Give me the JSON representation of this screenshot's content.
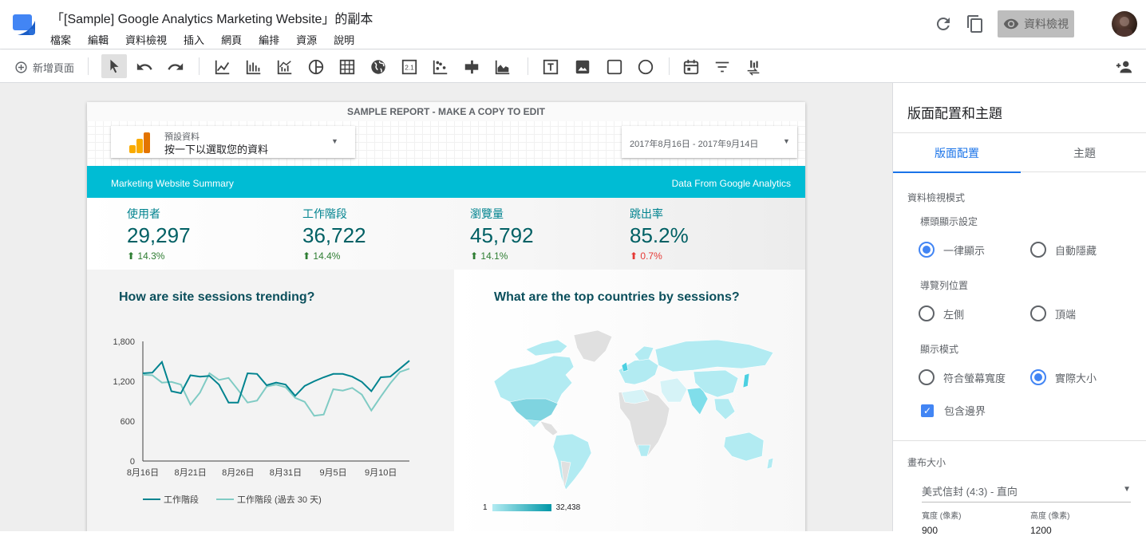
{
  "app": {
    "doc_title": "「[Sample] Google Analytics Marketing Website」的副本",
    "menu": [
      "檔案",
      "編輯",
      "資料檢視",
      "插入",
      "網頁",
      "編排",
      "資源",
      "說明"
    ],
    "view_button": "資料檢視"
  },
  "toolbar": {
    "add_page": "新增頁面",
    "tools": [
      "select-icon",
      "undo-icon",
      "redo-icon",
      "time-series-icon",
      "bar-chart-icon",
      "combo-chart-icon",
      "pie-chart-icon",
      "table-icon",
      "geo-map-icon",
      "scorecard-icon",
      "scatter-icon",
      "bullet-chart-icon",
      "area-chart-icon",
      "text-icon",
      "image-icon",
      "rectangle-icon",
      "circle-icon",
      "date-range-icon",
      "filter-icon",
      "data-control-icon"
    ],
    "share_icon": "person-add-icon"
  },
  "report": {
    "banner": "SAMPLE REPORT - MAKE A COPY TO EDIT",
    "data_picker": {
      "small": "預設資料",
      "main": "按一下以選取您的資料"
    },
    "date_range": "2017年8月16日 - 2017年9月14日",
    "summary_left": "Marketing Website Summary",
    "summary_right": "Data From Google Analytics",
    "kpis": [
      {
        "label": "使用者",
        "value": "29,297",
        "change": "14.3%",
        "trend": "up-good"
      },
      {
        "label": "工作階段",
        "value": "36,722",
        "change": "14.4%",
        "trend": "up-good"
      },
      {
        "label": "瀏覽量",
        "value": "45,792",
        "change": "14.1%",
        "trend": "up-good"
      },
      {
        "label": "跳出率",
        "value": "85.2%",
        "change": "0.7%",
        "trend": "up-bad"
      }
    ],
    "trend_title": "How are site sessions trending?",
    "map_title": "What are the top countries by sessions?",
    "map_legend": {
      "min": "1",
      "max": "32,438"
    }
  },
  "chart_data": {
    "type": "line",
    "title": "How are site sessions trending?",
    "ylim": [
      0,
      1800
    ],
    "yticks": [
      "0",
      "600",
      "1,200",
      "1,800"
    ],
    "xticks": [
      "8月16日",
      "8月21日",
      "8月26日",
      "8月31日",
      "9月5日",
      "9月10日"
    ],
    "colors": [
      "#00838f",
      "#80cbc4"
    ],
    "series": [
      {
        "name": "工作階段",
        "values": [
          1320,
          1330,
          1490,
          1050,
          1020,
          1290,
          1270,
          1280,
          1150,
          880,
          880,
          1320,
          1310,
          1140,
          1180,
          1150,
          980,
          1130,
          1200,
          1260,
          1310,
          1310,
          1270,
          1190,
          1050,
          1260,
          1270,
          1390,
          1510
        ]
      },
      {
        "name": "工作階段 (過去 30 天)",
        "values": [
          1300,
          1290,
          1180,
          1190,
          1150,
          850,
          1030,
          1320,
          1220,
          1250,
          1070,
          880,
          910,
          1120,
          1150,
          1110,
          950,
          890,
          680,
          700,
          1080,
          1060,
          1100,
          1000,
          760,
          970,
          1170,
          1340,
          1390
        ]
      }
    ]
  },
  "side_panel": {
    "title": "版面配置和主題",
    "tabs": [
      "版面配置",
      "主題"
    ],
    "section_view_mode": "資料檢視模式",
    "header_display": "標頭顯示設定",
    "header_options": [
      "一律顯示",
      "自動隱藏"
    ],
    "nav_position": "導覽列位置",
    "nav_options": [
      "左側",
      "頂端"
    ],
    "display_mode": "顯示模式",
    "display_options": [
      "符合螢幕寬度",
      "實際大小"
    ],
    "include_border": "包含邊界",
    "canvas_size": "畫布大小",
    "canvas_select": "美式信封 (4:3) - 直向",
    "width_label": "寬度 (像素)",
    "height_label": "高度 (像素)",
    "width_value": "900",
    "height_value": "1200"
  }
}
